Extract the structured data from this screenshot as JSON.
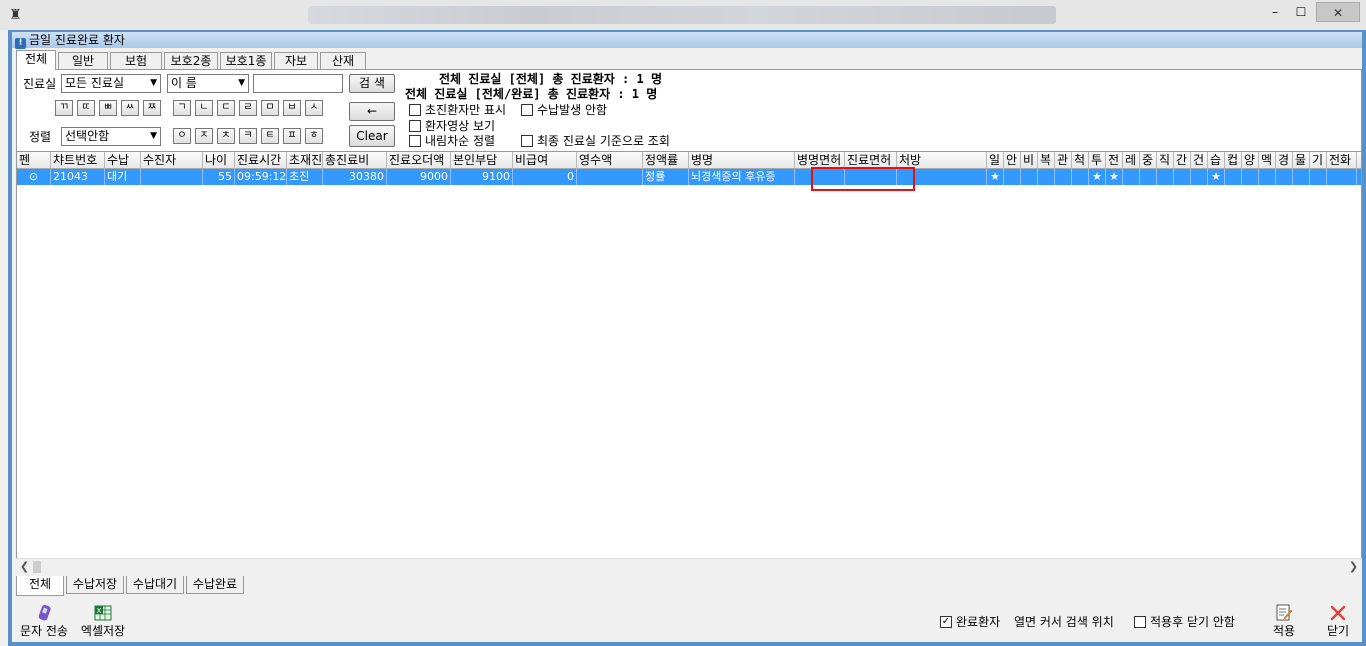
{
  "window": {
    "min": "–",
    "max": "☐",
    "close": "✕"
  },
  "panel_title": "금일 진료완료 환자",
  "tabs": [
    "전체",
    "일반",
    "보험",
    "보호2종",
    "보호1종",
    "자보",
    "산재"
  ],
  "filters": {
    "room_label": "진료실",
    "room_value": "모든 진료실",
    "name_select": "이 름",
    "search_button": "검 색",
    "sort_label": "정렬",
    "sort_value": "선택안함",
    "back_button": "←",
    "clear_button": "Clear",
    "consonants_row1": [
      "ㄲ",
      "ㄸ",
      "ㅃ",
      "ㅆ",
      "ㅉ",
      "ㄱ",
      "ㄴ",
      "ㄷ",
      "ㄹ",
      "ㅁ",
      "ㅂ",
      "ㅅ"
    ],
    "consonants_row2": [
      "ㅇ",
      "ㅈ",
      "ㅊ",
      "ㅋ",
      "ㅌ",
      "ㅍ",
      "ㅎ"
    ]
  },
  "summary": {
    "line1": "전체 진료실 [전체] 총 진료환자 : 1 명",
    "line2": "전체 진료실 [전체/완료] 총 진료환자 : 1 명"
  },
  "checkboxes": {
    "first_visit": "초진환자만 표시",
    "no_payment": "수납발생 안함",
    "patient_image": "환자영상 보기",
    "desc_sort": "내림차순 정렬",
    "final_room": "최종 진료실 기준으로 조회"
  },
  "columns": [
    "펜",
    "챠트번호",
    "수납",
    "수진자",
    "나이",
    "진료시간",
    "초재진",
    "총진료비",
    "진료오더액",
    "본인부담",
    "비급여",
    "영수액",
    "정액률",
    "병명",
    "병명면허",
    "진료면허",
    "처방",
    "일",
    "안",
    "비",
    "복",
    "관",
    "척",
    "투",
    "전",
    "레",
    "중",
    "직",
    "간",
    "건",
    "습",
    "컵",
    "양",
    "멕",
    "경",
    "물",
    "기",
    "전화"
  ],
  "rows": [
    {
      "cells": [
        "⊙",
        "21043",
        "대기",
        "",
        "55",
        "09:59:12",
        "초진",
        "30380",
        "9000",
        "9100",
        "0",
        "",
        "정률",
        "뇌경색증의 후유증",
        "",
        "",
        "",
        "★",
        "",
        "",
        "",
        "",
        "",
        "★",
        "★",
        "",
        "",
        "",
        "",
        "",
        "★",
        "",
        "",
        "",
        "",
        "",
        "",
        ""
      ]
    }
  ],
  "bottom_tabs": [
    "전체",
    "수납저장",
    "수납대기",
    "수납완료"
  ],
  "toolbar": {
    "sms_label": "문자 전송",
    "excel_label": "엑셀저장",
    "done_label": "완료환자",
    "open_cursor_label": "열면 커서 검색 위치",
    "keep_open_label": "적용후 닫기 안함",
    "apply_label": "적용",
    "close_label": "닫기"
  },
  "colors": {
    "selection": "#3399ff",
    "frame": "#5a90c8",
    "highlight_box": "#e81010"
  }
}
